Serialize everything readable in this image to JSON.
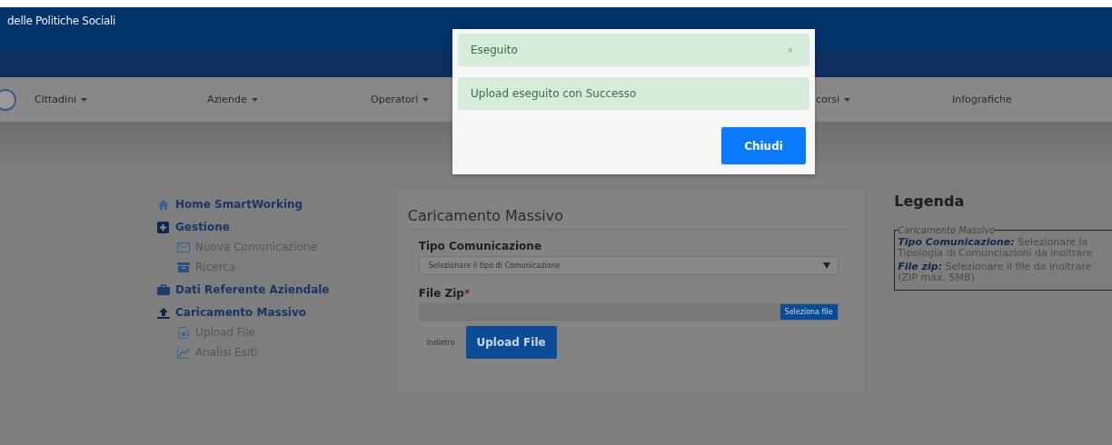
{
  "header": {
    "title": "delle Politiche Sociali"
  },
  "nav": [
    {
      "label": "Cittadini",
      "dropdown": true
    },
    {
      "label": "Aziende",
      "dropdown": true
    },
    {
      "label": "Operatori",
      "dropdown": true
    },
    {
      "label": "corsi",
      "dropdown": true
    },
    {
      "label": "Infografiche",
      "dropdown": false
    }
  ],
  "sidebar": [
    {
      "label": "Home SmartWorking",
      "kind": "home"
    },
    {
      "label": "Gestione",
      "kind": "plus",
      "children": [
        {
          "label": "Nuova Comunicazione",
          "kind": "mail"
        },
        {
          "label": "Ricerca",
          "kind": "archive"
        }
      ]
    },
    {
      "label": "Dati Referente Aziendale",
      "kind": "briefcase"
    },
    {
      "label": "Caricamento Massivo",
      "kind": "upload",
      "children": [
        {
          "label": "Upload File",
          "kind": "file"
        },
        {
          "label": "Analisi Esiti",
          "kind": "chart"
        }
      ]
    }
  ],
  "form": {
    "title": "Caricamento Massivo",
    "type_label": "Tipo Comunicazione",
    "type_placeholder": "Selezionare il tipo di Comunicazione",
    "file_label": "File Zip",
    "required_mark": "*",
    "file_button": "Seleziona file",
    "back_link": "Indietro",
    "upload_button": "Upload File"
  },
  "legend": {
    "title": "Legenda",
    "group": "Caricamento Massivo",
    "entries": [
      {
        "term": "Tipo Comunicazione:",
        "text": "Selezionare la Tipologia di Comunciazioni da inoltrare"
      },
      {
        "term": "File zip:",
        "text": "Selezionare il file da inoltrare (ZIP max. 5MB)"
      }
    ]
  },
  "modal": {
    "title": "Eseguito",
    "close": "×",
    "message": "Upload eseguito con Successo",
    "button": "Chiudi"
  }
}
